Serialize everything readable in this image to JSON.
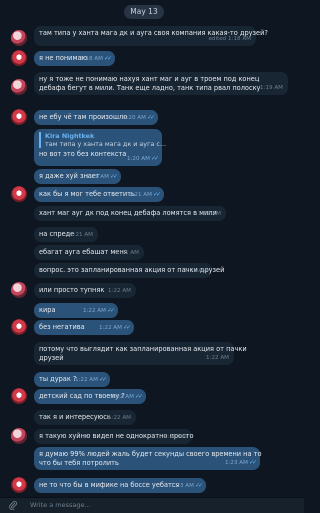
{
  "date": "May 13",
  "messages": [
    {
      "dir": "in",
      "text": [
        "там типа у ханта мага дк и ауга своя компания какая-то друзей?"
      ],
      "time": "edited 1:18 AM"
    },
    {
      "dir": "out",
      "text": [
        "я не понимаю"
      ],
      "time": "1:18 AM"
    },
    {
      "dir": "in",
      "text": [
        "ну я тоже не понимаю нахуя хант маг и ауг в троем под конец",
        "дебафа бегут в мили. Танк еще ладно, танк типа рвал полоску"
      ],
      "time": "1:19 AM"
    },
    {
      "dir": "out",
      "text": [
        "не ебу чё там произошло"
      ],
      "time": "1:20 AM"
    },
    {
      "dir": "out",
      "reply_name": "Kira Nightkek",
      "reply_text": "там типа у ханта мага дк и ауга с...",
      "text": [
        "но вот это без контекста"
      ],
      "time": "1:20 AM"
    },
    {
      "dir": "out",
      "text": [
        "я даже хуй знает"
      ],
      "time": "1:21 AM"
    },
    {
      "dir": "out",
      "text": [
        "как бы я мог тебе ответить"
      ],
      "time": "1:21 AM"
    },
    {
      "dir": "in",
      "text": [
        "хант маг ауг дк под конец дебафа ломятся в  мили"
      ],
      "time": "1:21 AM"
    },
    {
      "dir": "in",
      "text": [
        "на спреде"
      ],
      "time": "1:21 AM"
    },
    {
      "dir": "in",
      "text": [
        "ебагат ауга ебашат меня"
      ],
      "time": "1:21 AM"
    },
    {
      "dir": "in",
      "text": [
        "вопрос. это запланированная акция от пачки друзей"
      ],
      "time": "1:21 AM"
    },
    {
      "dir": "in",
      "text": [
        "или просто тупняк"
      ],
      "time": "1:22 AM"
    },
    {
      "dir": "out",
      "text": [
        "кира"
      ],
      "time": "1:22 AM"
    },
    {
      "dir": "out",
      "text": [
        "без негатива"
      ],
      "time": "1:22 AM"
    },
    {
      "dir": "in",
      "text": [
        "потому что выглядит как запланированная акция от пачки",
        "друзей"
      ],
      "time": "1:22 AM"
    },
    {
      "dir": "out",
      "text": [
        "ты дурак ?"
      ],
      "time": "1:22 AM"
    },
    {
      "dir": "out",
      "text": [
        "детский сад по твоему ?"
      ],
      "time": "1:22 AM"
    },
    {
      "dir": "in",
      "text": [
        "так я и интересуюсь"
      ],
      "time": "1:22 AM"
    },
    {
      "dir": "in",
      "text": [
        "я такую хуйню видел не однократно просто"
      ],
      "time": "1:23 AM"
    },
    {
      "dir": "out",
      "text": [
        "я думаю 99% людей жаль будет секунды своего времени на то",
        "что бы тебя потролить"
      ],
      "time": "1:23 AM"
    },
    {
      "dir": "out",
      "text": [
        "не то что бы в мифике на боссе уебатся"
      ],
      "time": "1:23 AM"
    }
  ],
  "composer": {
    "placeholder": "Write a message..."
  }
}
